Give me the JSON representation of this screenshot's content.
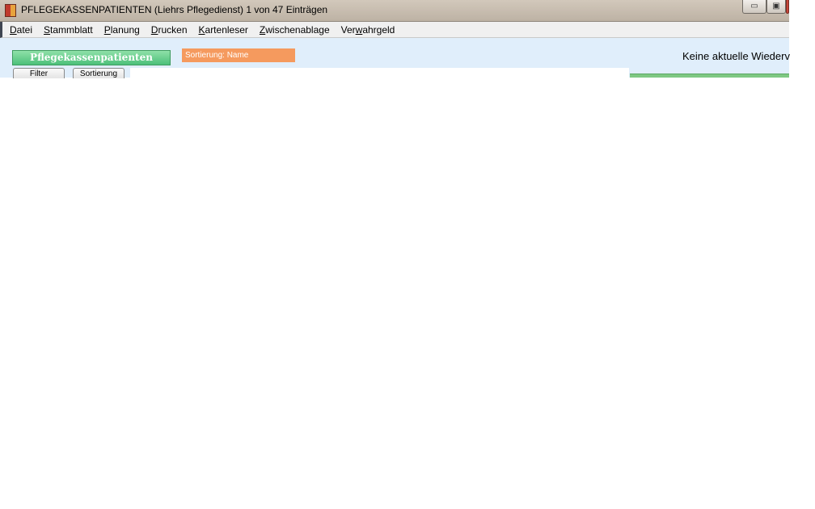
{
  "window": {
    "title": "PFLEGEKASSENPATIENTEN (Liehrs Pflegedienst) 1 von 47 Einträgen",
    "minimize_glyph": "▭",
    "maximize_glyph": "▣"
  },
  "menu": {
    "items": [
      {
        "first": "D",
        "rest": "atei"
      },
      {
        "first": "S",
        "rest": "tammblatt"
      },
      {
        "first": "P",
        "rest": "lanung"
      },
      {
        "first": "D",
        "rest": "rucken"
      },
      {
        "first": "K",
        "rest": "artenleser"
      },
      {
        "first": "Z",
        "rest": "wischenablage"
      },
      {
        "pre": "Ver",
        "first": "w",
        "rest": "ahrgeld"
      }
    ]
  },
  "header": {
    "title": "Pflegekassenpatienten",
    "sort_label": "Sortierung: Name",
    "status": "Keine aktuelle Wiederv"
  },
  "buttons": {
    "filter": "Filter",
    "sort": "Sortierung"
  },
  "colors": {
    "header_green": "#4cc07a",
    "sort_orange": "#f59a5e",
    "panel_blue": "#e0eefb"
  }
}
